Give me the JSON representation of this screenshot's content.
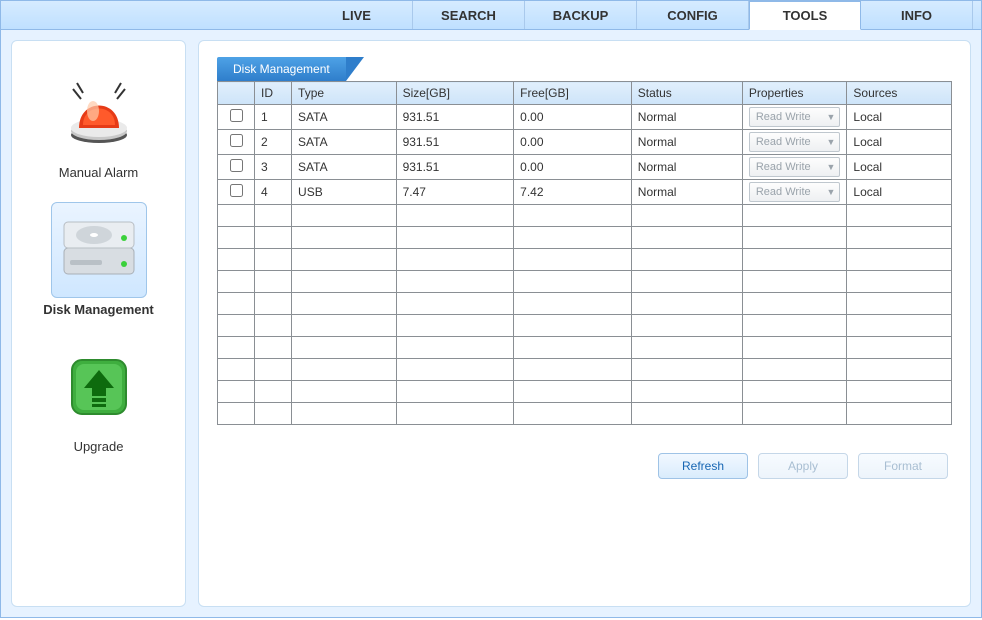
{
  "tabs": {
    "items": [
      "LIVE",
      "SEARCH",
      "BACKUP",
      "CONFIG",
      "TOOLS",
      "INFO"
    ],
    "active": "TOOLS"
  },
  "sidebar": {
    "items": [
      {
        "label": "Manual Alarm",
        "icon": "alarm-icon"
      },
      {
        "label": "Disk Management",
        "icon": "disks-icon"
      },
      {
        "label": "Upgrade",
        "icon": "upgrade-icon"
      }
    ],
    "selected": "Disk Management"
  },
  "panel": {
    "title": "Disk Management",
    "columns": {
      "check": "",
      "id": "ID",
      "type": "Type",
      "size": "Size[GB]",
      "free": "Free[GB]",
      "status": "Status",
      "properties": "Properties",
      "sources": "Sources"
    },
    "rows": [
      {
        "id": "1",
        "type": "SATA",
        "size": "931.51",
        "free": "0.00",
        "status": "Normal",
        "properties": "Read Write",
        "sources": "Local"
      },
      {
        "id": "2",
        "type": "SATA",
        "size": "931.51",
        "free": "0.00",
        "status": "Normal",
        "properties": "Read Write",
        "sources": "Local"
      },
      {
        "id": "3",
        "type": "SATA",
        "size": "931.51",
        "free": "0.00",
        "status": "Normal",
        "properties": "Read Write",
        "sources": "Local"
      },
      {
        "id": "4",
        "type": "USB",
        "size": "7.47",
        "free": "7.42",
        "status": "Normal",
        "properties": "Read Write",
        "sources": "Local"
      }
    ],
    "empty_rows": 10
  },
  "buttons": {
    "refresh": "Refresh",
    "apply": "Apply",
    "format": "Format"
  }
}
